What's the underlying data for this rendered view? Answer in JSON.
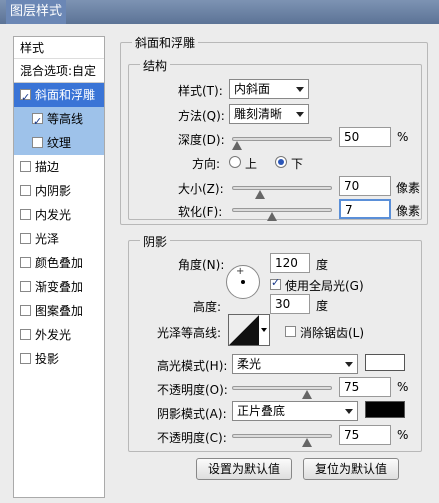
{
  "window": {
    "title": "图层样式"
  },
  "styles_panel": {
    "header": "样式",
    "blend_options": "混合选项:自定",
    "items": [
      {
        "label": "斜面和浮雕",
        "checked": true
      },
      {
        "label": "等高线",
        "checked": true
      },
      {
        "label": "纹理",
        "checked": false
      },
      {
        "label": "描边",
        "checked": false
      },
      {
        "label": "内阴影",
        "checked": false
      },
      {
        "label": "内发光",
        "checked": false
      },
      {
        "label": "光泽",
        "checked": false
      },
      {
        "label": "颜色叠加",
        "checked": false
      },
      {
        "label": "渐变叠加",
        "checked": false
      },
      {
        "label": "图案叠加",
        "checked": false
      },
      {
        "label": "外发光",
        "checked": false
      },
      {
        "label": "投影",
        "checked": false
      }
    ]
  },
  "bevel": {
    "section_title": "斜面和浮雕",
    "structure_title": "结构",
    "style_label": "样式(T):",
    "style_value": "内斜面",
    "method_label": "方法(Q):",
    "method_value": "雕刻清晰",
    "depth_label": "深度(D):",
    "depth_value": "50",
    "depth_fraction": 0.05,
    "percent_unit": "%",
    "direction_label": "方向:",
    "dir_up": "上",
    "dir_down": "下",
    "direction_selected": "down",
    "size_label": "大小(Z):",
    "size_value": "70",
    "size_fraction": 0.28,
    "pixel_unit": "像素",
    "soften_label": "软化(F):",
    "soften_value": "7",
    "soften_fraction": 0.4
  },
  "shading": {
    "title": "阴影",
    "angle_label": "角度(N):",
    "angle_value": "120",
    "degree_unit": "度",
    "global_light_label": "使用全局光(G)",
    "global_light_checked": true,
    "altitude_label": "高度:",
    "altitude_value": "30",
    "gloss_contour_label": "光泽等高线:",
    "anti_alias_label": "消除锯齿(L)",
    "anti_alias_checked": false,
    "highlight_mode_label": "高光模式(H):",
    "highlight_mode_value": "柔光",
    "highlight_color": "#ffffff",
    "highlight_opacity_label": "不透明度(O):",
    "highlight_opacity_value": "75",
    "highlight_opacity_fraction": 0.75,
    "shadow_mode_label": "阴影模式(A):",
    "shadow_mode_value": "正片叠底",
    "shadow_color": "#000000",
    "shadow_opacity_label": "不透明度(C):",
    "shadow_opacity_value": "75",
    "shadow_opacity_fraction": 0.75,
    "percent_unit": "%"
  },
  "buttons": {
    "make_default": "设置为默认值",
    "reset_default": "复位为默认值"
  }
}
